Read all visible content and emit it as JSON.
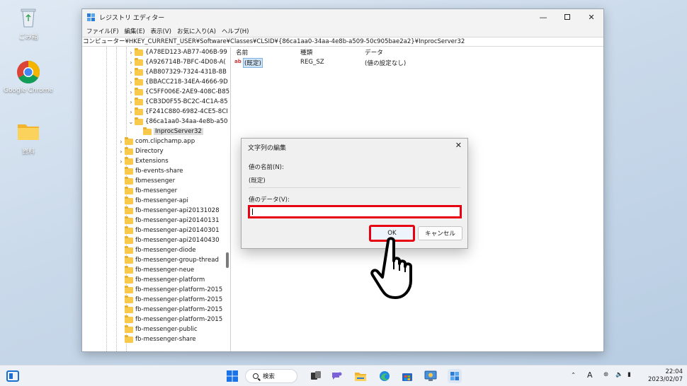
{
  "desktop": {
    "icons": [
      {
        "label": "ごみ箱",
        "icon": "recycle-bin-icon"
      },
      {
        "label": "Google Chrome",
        "icon": "chrome-icon"
      },
      {
        "label": "資料",
        "icon": "folder-icon"
      }
    ]
  },
  "window": {
    "title": "レジストリ エディター",
    "menu": [
      "ファイル(F)",
      "編集(E)",
      "表示(V)",
      "お気に入り(A)",
      "ヘルプ(H)"
    ],
    "address": "コンピューター¥HKEY_CURRENT_USER¥Software¥Classes¥CLSID¥{86ca1aa0-34aa-4e8b-a509-50c905bae2a2}¥InprocServer32",
    "tree": {
      "guid_nodes": [
        "{A78ED123-AB77-406B-99",
        "{A926714B-7BFC-4D08-A(",
        "{AB807329-7324-431B-8B",
        "{BBACC218-34EA-4666-9D",
        "{C5FF006E-2AE9-408C-B85",
        "{CB3D0F55-BC2C-4C1A-85",
        "{F241C880-6982-4CE5-8CI",
        "{86ca1aa0-34aa-4e8b-a50"
      ],
      "child_node": "InprocServer32",
      "class_nodes": [
        "com.clipchamp.app",
        "Directory",
        "Extensions",
        "fb-events-share",
        "fbmessenger",
        "fb-messenger",
        "fb-messenger-api",
        "fb-messenger-api20131028",
        "fb-messenger-api20140131",
        "fb-messenger-api20140301",
        "fb-messenger-api20140430",
        "fb-messenger-diode",
        "fb-messenger-group-thread",
        "fb-messenger-neue",
        "fb-messenger-platform",
        "fb-messenger-platform-2015",
        "fb-messenger-platform-2015",
        "fb-messenger-platform-2015",
        "fb-messenger-platform-2015",
        "fb-messenger-public",
        "fb-messenger-share"
      ]
    },
    "list": {
      "headers": [
        "名前",
        "種類",
        "データ"
      ],
      "rows": [
        {
          "name": "(既定)",
          "type": "REG_SZ",
          "data": "(値の設定なし)"
        }
      ]
    }
  },
  "dialog": {
    "title": "文字列の編集",
    "value_name_label": "値の名前(N):",
    "value_name": "(既定)",
    "value_data_label": "値のデータ(V):",
    "value_data": "",
    "ok_label": "OK",
    "cancel_label": "キャンセル",
    "highlight_color": "#e60012"
  },
  "taskbar": {
    "search_label": "検索",
    "tray": {
      "ime": "A",
      "time": "22:04",
      "date": "2023/02/07"
    }
  }
}
